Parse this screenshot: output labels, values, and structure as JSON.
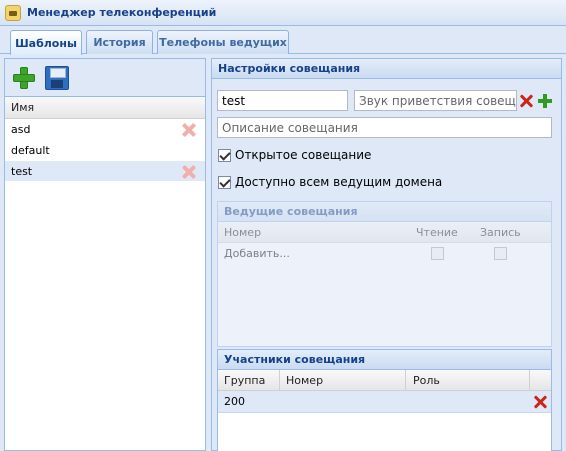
{
  "window": {
    "title": "Менеджер телеконференций",
    "icon": "conference-app-icon"
  },
  "tabs": [
    {
      "label": "Шаблоны",
      "active": true
    },
    {
      "label": "История",
      "active": false
    },
    {
      "label": "Телефоны ведущих",
      "active": false
    }
  ],
  "templates": {
    "toolbar": {
      "add_icon": "plus-icon",
      "save_icon": "floppy-disk-icon"
    },
    "column_header": "Имя",
    "rows": [
      {
        "name": "asd",
        "selected": false
      },
      {
        "name": "default",
        "selected": false
      },
      {
        "name": "test",
        "selected": true
      }
    ]
  },
  "settings": {
    "header": "Настройки совещания",
    "name_value": "test",
    "greeting_placeholder": "Звук приветствия совещания",
    "description_placeholder": "Описание совещания",
    "open_meeting_label": "Открытое совещание",
    "open_meeting_checked": true,
    "all_hosts_label": "Доступно всем ведущим домена",
    "all_hosts_checked": true
  },
  "hosts_panel": {
    "header": "Ведущие совещания",
    "disabled": true,
    "columns": [
      "Номер",
      "Чтение",
      "Запись"
    ],
    "add_row_label": "Добавить..."
  },
  "participants_panel": {
    "header": "Участники совещания",
    "columns": [
      "Группа",
      "Номер",
      "Роль"
    ],
    "rows": [
      {
        "group": "200",
        "number": "",
        "role": ""
      }
    ]
  },
  "colors": {
    "accent": "#15428b",
    "panel_bg": "#dfe8f6",
    "border": "#99bbe8",
    "delete_red": "#e24b3c",
    "add_green": "#3ea52b"
  }
}
